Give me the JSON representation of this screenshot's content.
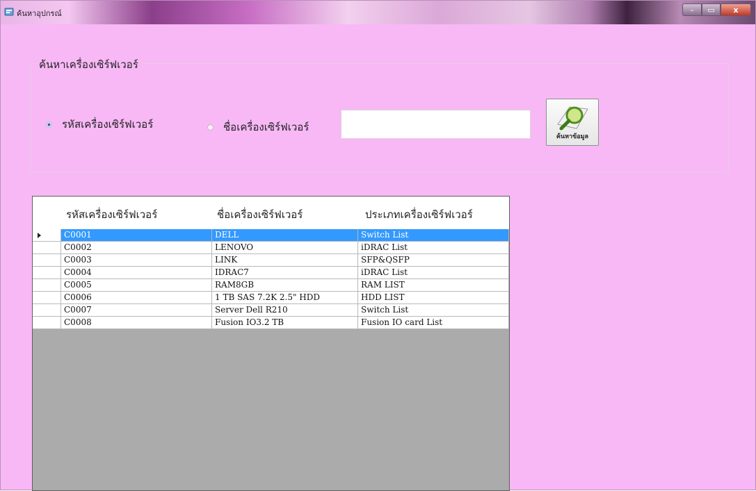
{
  "window": {
    "title": "ค้นหาอุปกรณ์",
    "controls": {
      "minimize": "–",
      "maximize": "▭",
      "close": "x"
    }
  },
  "search": {
    "group_label": "ค้นหาเครื่องเซิร์ฟเวอร์",
    "radio_code_label": "รหัสเครื่องเซิร์ฟเวอร์",
    "radio_code_checked": true,
    "radio_name_label": "ชื่อเครื่องเซิร์ฟเวอร์",
    "radio_name_checked": false,
    "input_value": "",
    "button_label": "ค้นหาข้อมูล",
    "button_icon": "magnifier-icon"
  },
  "grid": {
    "columns": [
      "รหัสเครื่องเซิร์ฟเวอร์",
      "ชื่อเครื่องเซิร์ฟเวอร์",
      "ประเภทเครื่องเซิร์ฟเวอร์"
    ],
    "selected_row": 0,
    "selection_color": "#3399ff",
    "rows": [
      [
        "C0001",
        "DELL",
        "Switch List"
      ],
      [
        "C0002",
        "LENOVO",
        "iDRAC List"
      ],
      [
        "C0003",
        "LINK",
        "SFP&QSFP"
      ],
      [
        "C0004",
        "IDRAC7",
        "iDRAC List"
      ],
      [
        "C0005",
        "RAM8GB",
        "RAM LIST"
      ],
      [
        "C0006",
        "1 TB SAS 7.2K 2.5\" HDD",
        "HDD LIST"
      ],
      [
        "C0007",
        "Server Dell R210",
        "Switch List"
      ],
      [
        "C0008",
        "Fusion IO3.2 TB",
        "Fusion IO card List"
      ]
    ]
  },
  "colors": {
    "form_background": "#f7b8f5",
    "grid_background": "#ababab"
  }
}
